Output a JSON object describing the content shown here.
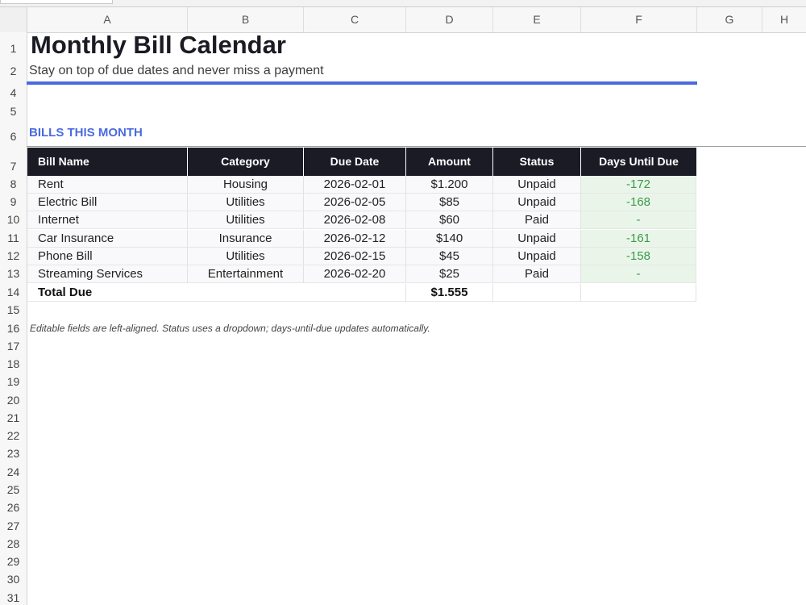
{
  "columns": [
    "A",
    "B",
    "C",
    "D",
    "E",
    "F",
    "G",
    "H"
  ],
  "rows": [
    "1",
    "2",
    "4",
    "5",
    "6",
    "7",
    "8",
    "9",
    "10",
    "11",
    "12",
    "13",
    "14",
    "15",
    "16",
    "17",
    "18",
    "19",
    "20",
    "21",
    "22",
    "23",
    "24",
    "25",
    "26",
    "27",
    "28",
    "29",
    "30",
    "31"
  ],
  "sheet": {
    "title": "Monthly Bill Calendar",
    "subtitle": "Stay on top of due dates and never miss a payment",
    "section_label": "BILLS THIS MONTH",
    "note": "Editable fields are left-aligned. Status uses a dropdown; days-until-due updates automatically."
  },
  "table": {
    "headers": [
      "Bill Name",
      "Category",
      "Due Date",
      "Amount",
      "Status",
      "Days Until Due"
    ],
    "rows": [
      [
        "Rent",
        "Housing",
        "2026-02-01",
        "$1.200",
        "Unpaid",
        "-172"
      ],
      [
        "Electric Bill",
        "Utilities",
        "2026-02-05",
        "$85",
        "Unpaid",
        "-168"
      ],
      [
        "Internet",
        "Utilities",
        "2026-02-08",
        "$60",
        "Paid",
        "-"
      ],
      [
        "Car Insurance",
        "Insurance",
        "2026-02-12",
        "$140",
        "Unpaid",
        "-161"
      ],
      [
        "Phone Bill",
        "Utilities",
        "2026-02-15",
        "$45",
        "Unpaid",
        "-158"
      ],
      [
        "Streaming Services",
        "Entertainment",
        "2026-02-20",
        "$25",
        "Paid",
        "-"
      ]
    ],
    "total_label": "Total Due",
    "total_amount": "$1.555"
  },
  "colors": {
    "accent": "#4a6ae0",
    "header_bg": "#1b1b26",
    "days_fill": "#eaf5ea",
    "days_text": "#3a9a4a"
  }
}
